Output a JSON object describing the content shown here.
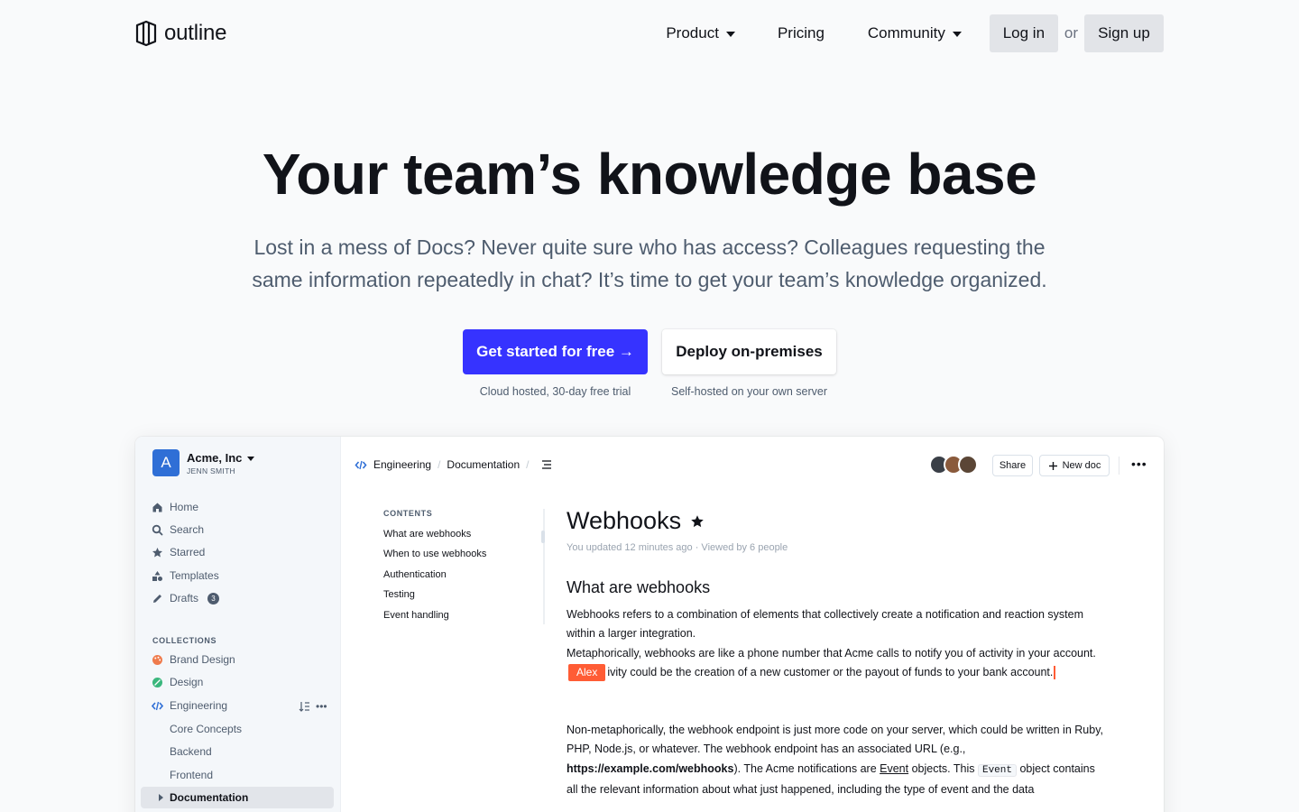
{
  "nav": {
    "logo_text": "outline",
    "product": "Product",
    "pricing": "Pricing",
    "community": "Community",
    "login": "Log in",
    "or": "or",
    "signup": "Sign up"
  },
  "hero": {
    "title": "Your team’s knowledge base",
    "subtitle": "Lost in a mess of Docs? Never quite sure who has access? Colleagues requesting the same information repeatedly in chat? It’s time to get your team’s knowledge organized.",
    "cta_primary": "Get started for free →",
    "cta_secondary": "Deploy on-premises",
    "note_primary": "Cloud hosted, 30-day free trial",
    "note_secondary": "Self-hosted on your own server"
  },
  "app": {
    "team": {
      "initial": "A",
      "name": "Acme, Inc",
      "user": "JENN SMITH"
    },
    "sidebar": {
      "home": "Home",
      "search": "Search",
      "starred": "Starred",
      "templates": "Templates",
      "drafts": "Drafts",
      "drafts_count": "3",
      "collections_heading": "COLLECTIONS",
      "brand_design": "Brand Design",
      "design": "Design",
      "engineering": "Engineering",
      "core_concepts": "Core Concepts",
      "backend": "Backend",
      "frontend": "Frontend",
      "documentation": "Documentation"
    },
    "breadcrumb": {
      "collection": "Engineering",
      "doc": "Documentation"
    },
    "toolbar": {
      "share": "Share",
      "new_doc": "New doc",
      "more": "•••"
    },
    "toc": {
      "heading": "CONTENTS",
      "items": [
        "What are webhooks",
        "When to use webhooks",
        "Authentication",
        "Testing",
        "Event handling"
      ]
    },
    "doc": {
      "title": "Webhooks",
      "meta": "You updated 12 minutes ago · Viewed by 6 people",
      "h2": "What are webhooks",
      "p1_a": "Webhooks refers to a combination of elements that collectively create a notification and reaction system within a larger integration.",
      "p1_b": "Metaphorically, webhooks are like a phone number that Acme calls to notify you of activity in your account.",
      "p1_c": "ivity could be the creation of a new customer or the payout of funds to your bank account.",
      "collaborator": "Alex",
      "p2_a": "Non-metaphorically, the webhook endpoint is just more code on your server, which could be written in Ruby, PHP, Node.js, or whatever. The webhook endpoint has an associated URL (e.g., ",
      "p2_url": "https://example.com/webhooks",
      "p2_b": "). The Acme notifications are ",
      "p2_event": "Event",
      "p2_c": " objects. This ",
      "p2_code": "Event",
      "p2_d": " object contains all the relevant information about what just happened, including the type of event and the data"
    }
  },
  "colors": {
    "primary": "#3633ff",
    "collab": "#ff5c35",
    "team": "#2f6fd6",
    "text": "#111319",
    "muted": "#4e5c6e"
  }
}
